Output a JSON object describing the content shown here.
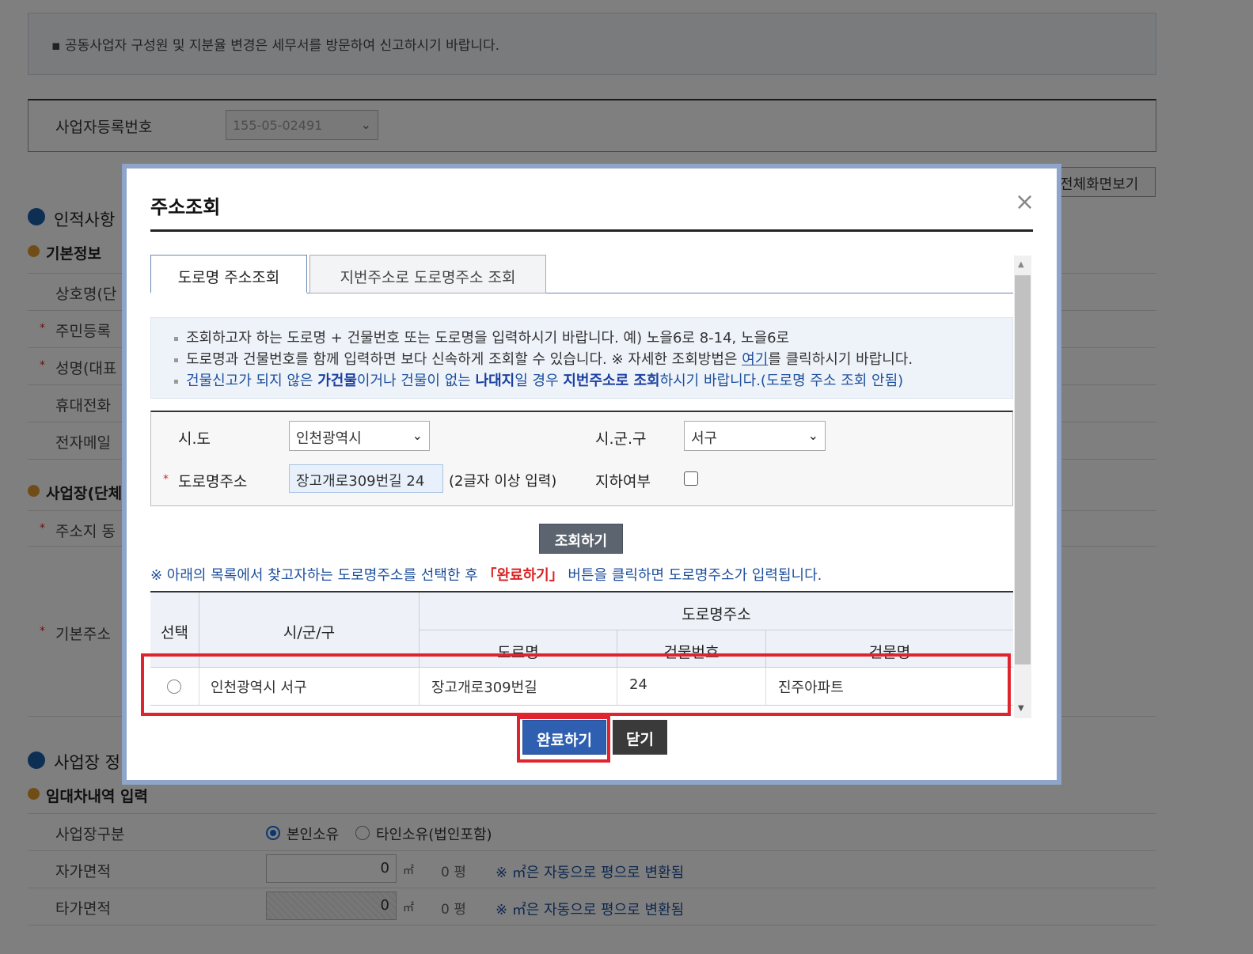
{
  "background": {
    "notice": "공동사업자 구성원 및 지분율 변경은 세무서를 방문하여 신고하시기 바랍니다.",
    "bizno_label": "사업자등록번호",
    "bizno_value": "155-05-02491",
    "fullview_button": "전체화면보기",
    "section1_title": "인적사항",
    "basic_info": "기본정보",
    "rows1": [
      "상호명(단",
      "주민등록",
      "성명(대표",
      "휴대전화",
      "전자메일"
    ],
    "workplace": "사업장(단체",
    "row_address": "주소지 동",
    "row_basic_address": "기본주소",
    "section2_title": "사업장 정",
    "lease_title": "임대차내역 입력",
    "workplace_type_label": "사업장구분",
    "radio_own": "본인소유",
    "radio_other": "타인소유(법인포함)",
    "own_area_label": "자가면적",
    "other_area_label": "타가면적",
    "area_value": "0",
    "unit_m2": "㎡",
    "pyeong": "0 평",
    "convert_note": "※ ㎡은 자동으로 평으로 변환됨"
  },
  "modal": {
    "title": "주소조회",
    "close_icon": "×",
    "tabs": [
      {
        "label": "도로명 주소조회"
      },
      {
        "label": "지번주소로 도로명주소 조회"
      }
    ],
    "info": {
      "line1": "조회하고자 하는 도로명 + 건물번호 또는 도로명을 입력하시기 바랍니다. 예) 노을6로 8-14, 노을6로",
      "line2_a": "도로명과 건물번호를 함께 입력하면 보다 신속하게 조회할 수 있습니다. ※ 자세한 조회방법은 ",
      "line2_link": "여기",
      "line2_b": "를 클릭하시기 바랍니다.",
      "line3_a": "건물신고가 되지 않은 ",
      "line3_b": "가건물",
      "line3_c": "이거나 건물이 없는 ",
      "line3_d": "나대지",
      "line3_e": "일 경우 ",
      "line3_f": "지번주소로 조회",
      "line3_g": "하시기 바랍니다.(도로명 주소 조회 안됨)"
    },
    "form": {
      "sido_label": "시.도",
      "sido_value": "인천광역시",
      "sigungu_label": "시.군.구",
      "sigungu_value": "서구",
      "road_label": "도로명주소",
      "road_value": "장고개로309번길 24",
      "road_hint": "(2글자 이상 입력)",
      "basement_label": "지하여부"
    },
    "search_button": "조회하기",
    "guide_a": "※ 아래의 목록에서 찾고자하는 도로명주소를 선택한 후 ",
    "guide_red": "「완료하기」",
    "guide_b": " 버튼을 클릭하면 도로명주소가 입력됩니다.",
    "table": {
      "col_select": "선택",
      "col_sigungu": "시/군/구",
      "col_road_group": "도로명주소",
      "col_road": "도로명",
      "col_bldg_no": "건물번호",
      "col_bldg_name": "건물명",
      "rows": [
        {
          "sigungu": "인천광역시 서구",
          "road": "장고개로309번길",
          "bldg_no": "24",
          "bldg_name": "진주아파트"
        }
      ]
    },
    "done_button": "완료하기",
    "close_button": "닫기"
  },
  "colors": {
    "accent": "#2f5fb0",
    "highlight": "#e0242f",
    "info_blue": "#1d4f9c"
  }
}
